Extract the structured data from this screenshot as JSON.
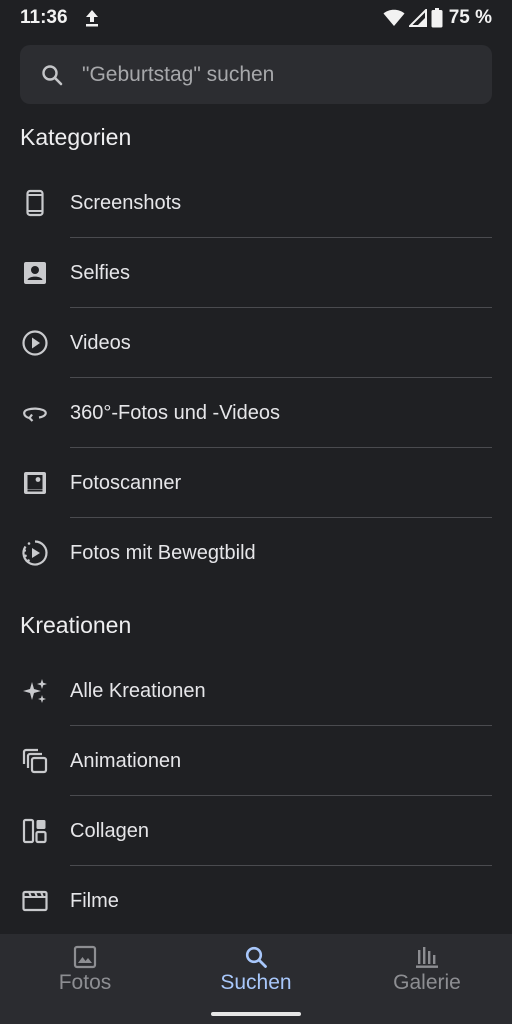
{
  "status_bar": {
    "time": "11:36",
    "battery": "75 %",
    "icons": [
      "upload-icon",
      "wifi-icon",
      "signal-icon",
      "battery-icon"
    ]
  },
  "search": {
    "placeholder": "\"Geburtstag\" suchen",
    "icon": "search-icon"
  },
  "categories": {
    "title": "Kategorien",
    "items": [
      {
        "label": "Screenshots",
        "icon": "phone-icon"
      },
      {
        "label": "Selfies",
        "icon": "portrait-icon"
      },
      {
        "label": "Videos",
        "icon": "play-circle-icon"
      },
      {
        "label": "360°-Fotos und -Videos",
        "icon": "rotate-360-icon"
      },
      {
        "label": "Fotoscanner",
        "icon": "photo-scanner-icon"
      },
      {
        "label": "Fotos mit Bewegtbild",
        "icon": "motion-photo-icon"
      }
    ]
  },
  "creations": {
    "title": "Kreationen",
    "items": [
      {
        "label": "Alle Kreationen",
        "icon": "sparkle-icon"
      },
      {
        "label": "Animationen",
        "icon": "animation-icon"
      },
      {
        "label": "Collagen",
        "icon": "collage-icon"
      },
      {
        "label": "Filme",
        "icon": "movie-icon"
      }
    ]
  },
  "bottom_nav": {
    "items": [
      {
        "label": "Fotos",
        "icon": "photo-icon",
        "active": false
      },
      {
        "label": "Suchen",
        "icon": "search-icon",
        "active": true
      },
      {
        "label": "Galerie",
        "icon": "library-icon",
        "active": false
      }
    ]
  },
  "colors": {
    "background": "#1f2023",
    "search_bg": "#2c2d31",
    "nav_bg": "#2b2c30",
    "accent": "#a8c7fa",
    "divider": "#4a4b4f"
  }
}
